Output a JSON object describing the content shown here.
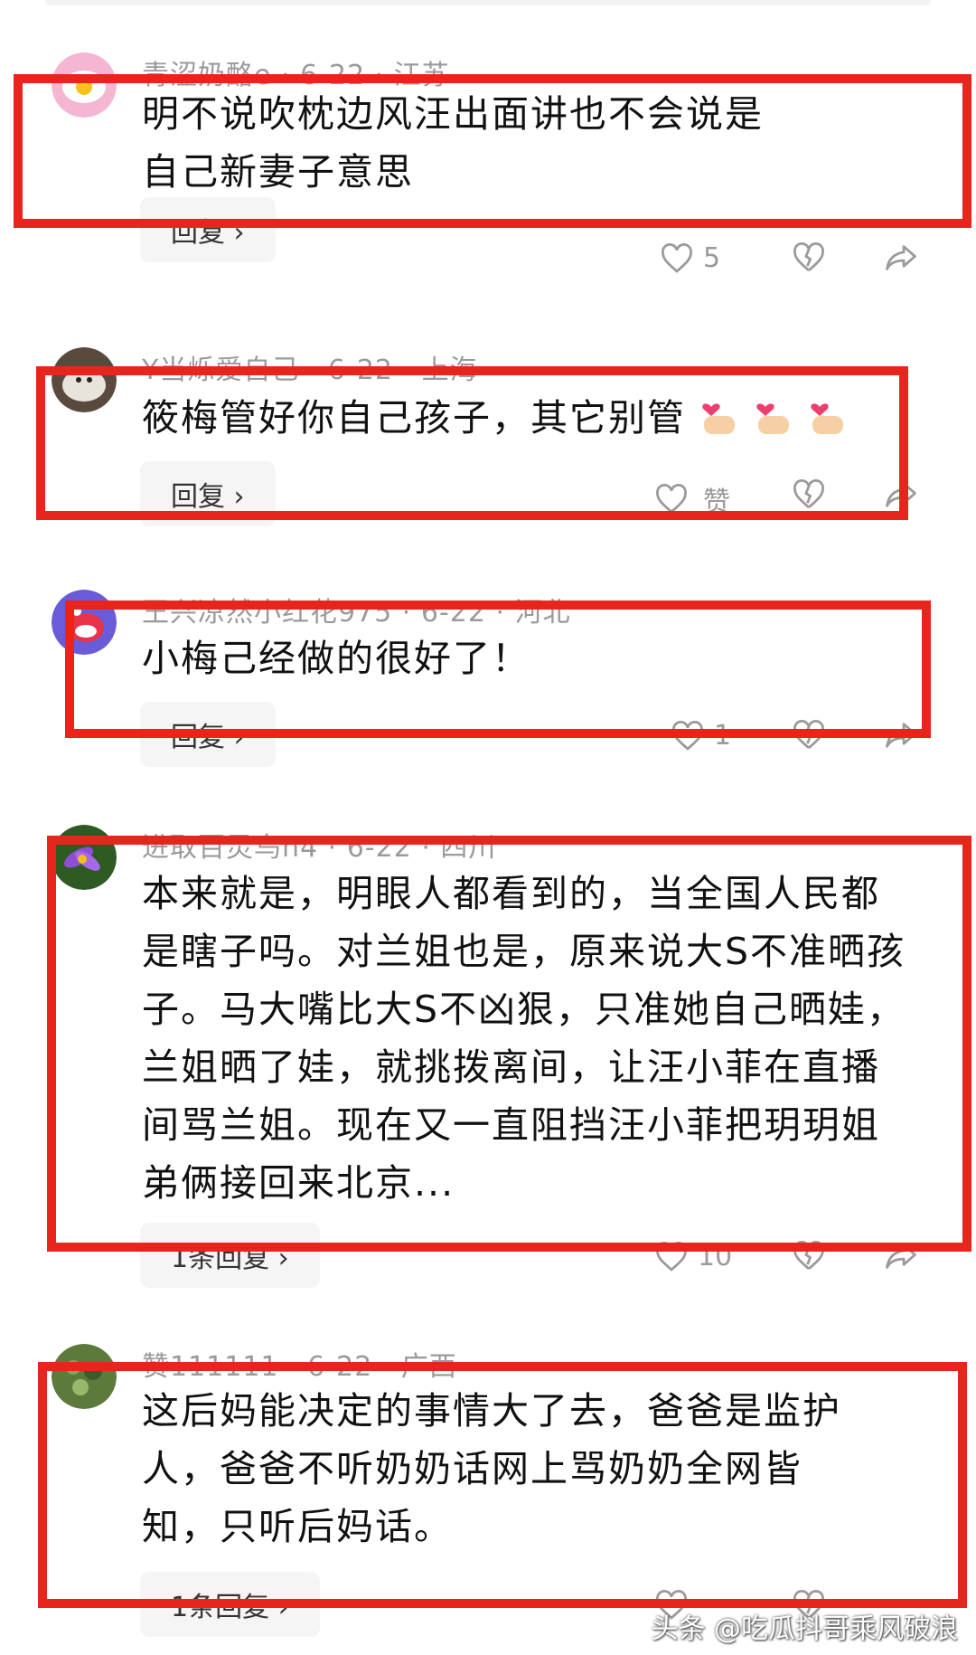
{
  "comments": [
    {
      "meta": "青涩奶酪e · 6-22 · 江苏",
      "content": "明不说吹枕边风汪出面讲也不会说是自己新妻子意思",
      "reply_label": "回复 ›",
      "like_count": "5",
      "avatar_icon": "fried-egg-avatar"
    },
    {
      "meta": "Y当烁爱自己 · 6-22 · 上海",
      "content": "筱梅管好你自己孩子，其它别管",
      "reply_label": "回复 ›",
      "like_count": "赞",
      "avatar_icon": "white-dog-avatar"
    },
    {
      "meta": "王兴凉然小红花975 · 6-22 · 河北",
      "content": "小梅己经做的很好了！",
      "reply_label": "回复 ›",
      "like_count": "1",
      "avatar_icon": "cartoon-face-avatar"
    },
    {
      "meta": "进取百灵鸟n4 · 6-22 · 四川",
      "content": "本来就是，明眼人都看到的，当全国人民都是瞎子吗。对兰姐也是，原来说大S不准晒孩子。马大嘴比大S不凶狠，只准她自己晒娃，兰姐晒了娃，就挑拨离间，让汪小菲在直播间骂兰姐。现在又一直阻挡汪小菲把玥玥姐弟俩接回来北京...",
      "reply_label": "1条回复 ›",
      "like_count": "10",
      "avatar_icon": "purple-flower-avatar"
    },
    {
      "meta": "赞111111 · 6-22 · 广西",
      "content": "这后妈能决定的事情大了去，爸爸是监护人，爸爸不听奶奶话网上骂奶奶全网皆知，只听后妈话。",
      "reply_label": "1条回复 ›",
      "like_count": "",
      "avatar_icon": "green-plant-avatar"
    }
  ],
  "watermark": "头条 @吃瓜抖哥乘风破浪",
  "colors": {
    "highlight_red": "#e8251d",
    "meta_gray": "#9a9a9a",
    "pill_bg": "#f5f5f5"
  }
}
